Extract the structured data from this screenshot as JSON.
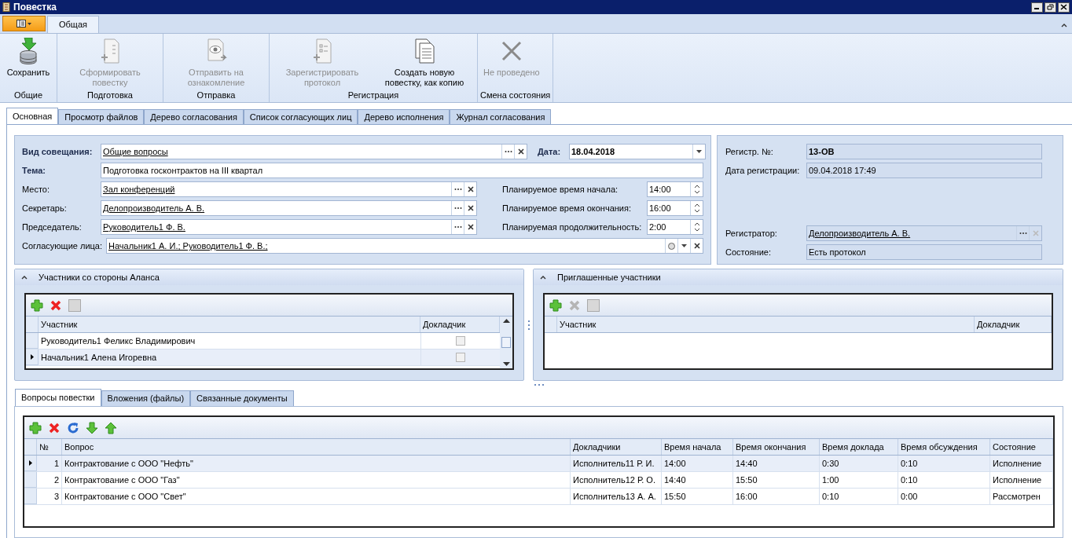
{
  "window": {
    "title": "Повестка"
  },
  "ribbon": {
    "tabs": [
      {
        "label": "Общая",
        "selected": true
      }
    ],
    "groups": [
      {
        "caption": "Общие",
        "buttons": [
          {
            "label": "Сохранить",
            "kind": "save",
            "disabled": false
          }
        ]
      },
      {
        "caption": "Подготовка",
        "buttons": [
          {
            "label": "Сформировать повестку",
            "kind": "form",
            "disabled": true
          }
        ]
      },
      {
        "caption": "Отправка",
        "buttons": [
          {
            "label": "Отправить на ознакомление",
            "kind": "send",
            "disabled": true
          }
        ]
      },
      {
        "caption": "Регистрация",
        "buttons": [
          {
            "label": "Зарегистрировать протокол",
            "kind": "register",
            "disabled": true
          },
          {
            "label": "Создать новую повестку, как копию",
            "kind": "copy",
            "disabled": false
          }
        ]
      },
      {
        "caption": "Смена состояния",
        "buttons": [
          {
            "label": "Не проведено",
            "kind": "cancel",
            "disabled": true
          }
        ]
      }
    ]
  },
  "doc_tabs": [
    {
      "label": "Основная",
      "selected": true
    },
    {
      "label": "Просмотр файлов",
      "selected": false
    },
    {
      "label": "Дерево согласования",
      "selected": false
    },
    {
      "label": "Список согласующих лиц",
      "selected": false
    },
    {
      "label": "Дерево исполнения",
      "selected": false
    },
    {
      "label": "Журнал согласования",
      "selected": false
    }
  ],
  "meeting": {
    "type": {
      "label": "Вид совещания:",
      "value": "Общие вопросы"
    },
    "date": {
      "label": "Дата:",
      "value": "18.04.2018"
    },
    "topic": {
      "label": "Тема:",
      "value": "Подготовка госконтрактов на III квартал"
    },
    "rows": [
      {
        "label": "Место:",
        "value": "Зал конференций",
        "time_label": "Планируемое время начала:",
        "time_value": "14:00"
      },
      {
        "label": "Секретарь:",
        "value": "Делопроизводитель А. В.",
        "time_label": "Планируемое время окончания:",
        "time_value": "16:00"
      },
      {
        "label": "Председатель:",
        "value": "Руководитель1 Ф. В.",
        "time_label": "Планируемая продолжительность:",
        "time_value": "2:00"
      }
    ],
    "approvers": {
      "label": "Согласующие лица:",
      "value": "Начальник1 А. И.; Руководитель1 Ф. В.;"
    }
  },
  "registration": {
    "number": {
      "label": "Регистр. №:",
      "value": "13-ОВ"
    },
    "date": {
      "label": "Дата регистрации:",
      "value": "09.04.2018 17:49"
    },
    "registrar": {
      "label": "Регистратор:",
      "value": "Делопроизводитель А. В."
    },
    "state": {
      "label": "Состояние:",
      "value": "Есть протокол"
    }
  },
  "participants": {
    "title": "Участники со стороны Аланса",
    "tools": [
      {
        "kind": "add",
        "disabled": false
      },
      {
        "kind": "delete",
        "disabled": false
      },
      {
        "kind": "edit",
        "disabled": true
      }
    ],
    "columns": [
      "Участник",
      "Докладчик"
    ],
    "rows": [
      {
        "name": "Руководитель1 Феликс Владимирович",
        "reporter": false,
        "selected": false
      },
      {
        "name": "Начальник1 Алена Игоревна",
        "reporter": false,
        "selected": true
      }
    ]
  },
  "invited": {
    "title": "Приглашенные участники",
    "tools": [
      {
        "kind": "add",
        "disabled": false
      },
      {
        "kind": "delete",
        "disabled": true
      },
      {
        "kind": "edit",
        "disabled": true
      }
    ],
    "columns": [
      "Участник",
      "Докладчик"
    ]
  },
  "bottom_tabs": [
    {
      "label": "Вопросы повестки",
      "selected": true
    },
    {
      "label": "Вложения (файлы)",
      "selected": false
    },
    {
      "label": "Связанные документы",
      "selected": false
    }
  ],
  "agenda": {
    "tools": [
      {
        "kind": "add",
        "disabled": false
      },
      {
        "kind": "delete",
        "disabled": false
      },
      {
        "kind": "refresh",
        "disabled": false
      },
      {
        "kind": "down",
        "disabled": false
      },
      {
        "kind": "up",
        "disabled": false
      }
    ],
    "columns": [
      "№",
      "Вопрос",
      "Докладчики",
      "Время начала",
      "Время окончания",
      "Время доклада",
      "Время обсуждения",
      "Состояние"
    ],
    "rows": [
      {
        "cells": [
          "1",
          "Контрактование с ООО \"Нефть\"",
          "Исполнитель11 Р. И.",
          "14:00",
          "14:40",
          "0:30",
          "0:10",
          "Исполнение"
        ],
        "selected": true
      },
      {
        "cells": [
          "2",
          "Контрактование с ООО \"Газ\"",
          "Исполнитель12 Р. О.",
          "14:40",
          "15:50",
          "1:00",
          "0:10",
          "Исполнение"
        ],
        "selected": false
      },
      {
        "cells": [
          "3",
          "Контрактование с ООО \"Свет\"",
          "Исполнитель13 А. А.",
          "15:50",
          "16:00",
          "0:10",
          "0:00",
          "Рассмотрен"
        ],
        "selected": false
      }
    ]
  }
}
